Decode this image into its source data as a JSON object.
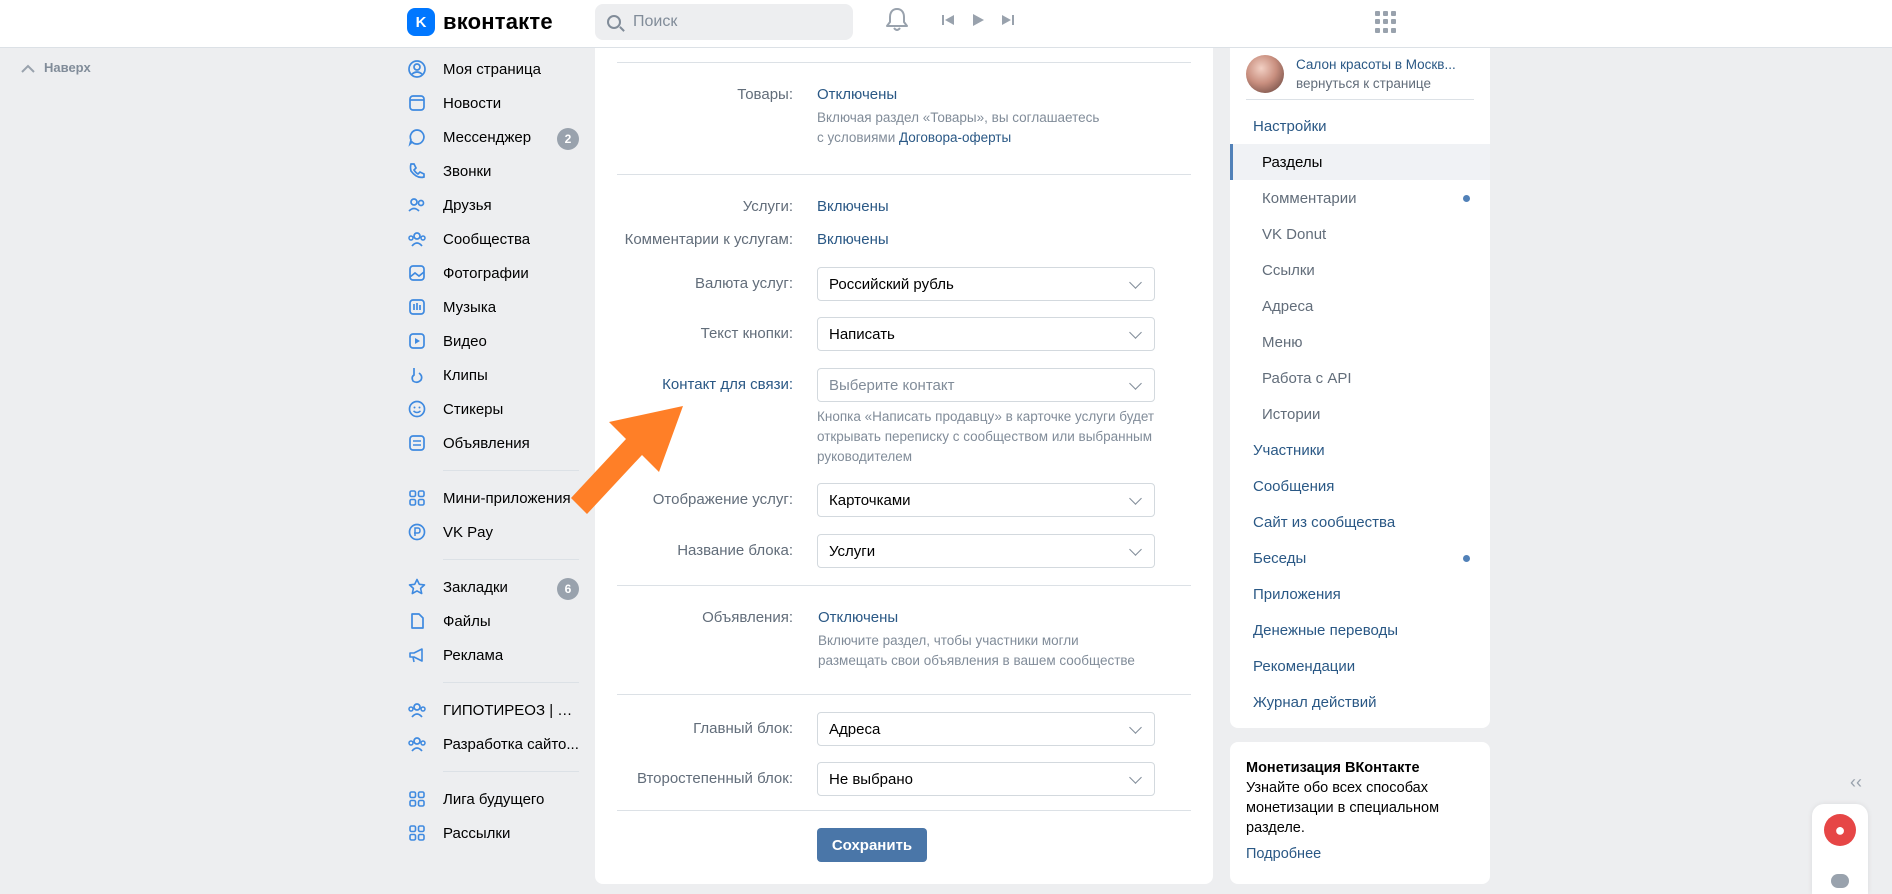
{
  "header": {
    "logo_letter": "K",
    "logo_text": "вконтакте",
    "search_placeholder": "Поиск",
    "icons": [
      "bell-icon",
      "prev-track-icon",
      "play-icon",
      "next-track-icon",
      "apps-grid-icon"
    ]
  },
  "scroll_top_label": "Наверх",
  "left_nav": {
    "group1": [
      {
        "label": "Моя страница",
        "icon": "user-circle-icon"
      },
      {
        "label": "Новости",
        "icon": "news-icon"
      },
      {
        "label": "Мессенджер",
        "icon": "message-icon",
        "badge": "2"
      },
      {
        "label": "Звонки",
        "icon": "phone-icon"
      },
      {
        "label": "Друзья",
        "icon": "friends-icon"
      },
      {
        "label": "Сообщества",
        "icon": "communities-icon"
      },
      {
        "label": "Фотографии",
        "icon": "photo-icon"
      },
      {
        "label": "Музыка",
        "icon": "music-icon"
      },
      {
        "label": "Видео",
        "icon": "video-icon"
      },
      {
        "label": "Клипы",
        "icon": "clips-icon"
      },
      {
        "label": "Стикеры",
        "icon": "smile-icon"
      },
      {
        "label": "Объявления",
        "icon": "classifieds-icon"
      }
    ],
    "group2": [
      {
        "label": "Мини-приложения",
        "icon": "apps-icon"
      },
      {
        "label": "VK Pay",
        "icon": "vkpay-icon"
      }
    ],
    "group3": [
      {
        "label": "Закладки",
        "icon": "star-icon",
        "badge": "6"
      },
      {
        "label": "Файлы",
        "icon": "file-icon"
      },
      {
        "label": "Реклама",
        "icon": "megaphone-icon"
      }
    ],
    "group4": [
      {
        "label": "ГИПОТИРЕОЗ | ПО...",
        "icon": "community-icon"
      },
      {
        "label": "Разработка сайто...",
        "icon": "community-icon"
      }
    ],
    "group5": [
      {
        "label": "Лига будущего",
        "icon": "apps-icon"
      },
      {
        "label": "Рассылки",
        "icon": "apps-icon"
      }
    ]
  },
  "form": {
    "goods": {
      "label": "Товары:",
      "value": "Отключены",
      "hint_before": "Включая раздел «Товары», вы соглашаетесь",
      "hint_line2": "с условиями ",
      "hint_link": "Договора-оферты"
    },
    "services": {
      "label": "Услуги:",
      "value": "Включены"
    },
    "service_comments": {
      "label": "Комментарии к услугам:",
      "value": "Включены"
    },
    "currency": {
      "label": "Валюта услуг:",
      "value": "Российский рубль"
    },
    "button_text": {
      "label": "Текст кнопки:",
      "value": "Написать"
    },
    "contact": {
      "label": "Контакт для связи:",
      "placeholder": "Выберите контакт",
      "hint": [
        "Кнопка «Написать продавцу» в карточке услуги будет",
        "открывать переписку с сообществом или выбранным",
        "руководителем"
      ]
    },
    "display": {
      "label": "Отображение услуг:",
      "value": "Карточками"
    },
    "block_name": {
      "label": "Название блока:",
      "value": "Услуги"
    },
    "ads": {
      "label": "Объявления:",
      "value": "Отключены",
      "hint": [
        "Включите раздел, чтобы участники могли",
        "размещать свои объявления в вашем сообществе"
      ]
    },
    "main_block": {
      "label": "Главный блок:",
      "value": "Адреса"
    },
    "secondary_block": {
      "label": "Второстепенный блок:",
      "value": "Не выбрано"
    },
    "save_label": "Сохранить"
  },
  "right_menu": {
    "group_name": "Салон красоты в Москв...",
    "group_back": "вернуться к странице",
    "items": [
      {
        "label": "Настройки",
        "type": "main"
      },
      {
        "label": "Разделы",
        "type": "active"
      },
      {
        "label": "Комментарии",
        "type": "sub",
        "dot": true
      },
      {
        "label": "VK Donut",
        "type": "sub"
      },
      {
        "label": "Ссылки",
        "type": "sub"
      },
      {
        "label": "Адреса",
        "type": "sub"
      },
      {
        "label": "Меню",
        "type": "sub"
      },
      {
        "label": "Работа с API",
        "type": "sub"
      },
      {
        "label": "Истории",
        "type": "sub"
      },
      {
        "label": "Участники",
        "type": "main"
      },
      {
        "label": "Сообщения",
        "type": "main"
      },
      {
        "label": "Сайт из сообщества",
        "type": "main"
      },
      {
        "label": "Беседы",
        "type": "main",
        "dot": true
      },
      {
        "label": "Приложения",
        "type": "main"
      },
      {
        "label": "Денежные переводы",
        "type": "main"
      },
      {
        "label": "Рекомендации",
        "type": "main"
      },
      {
        "label": "Журнал действий",
        "type": "main"
      }
    ]
  },
  "monetization": {
    "title": "Монетизация ВКонтакте",
    "text": "Узнайте обо всех способах монетизации в специальном разделе.",
    "link": "Подробнее"
  },
  "colors": {
    "accent": "#2a5885",
    "button": "#4a76a8",
    "icon": "#3f8ae0",
    "arrow": "#ff7f27",
    "background": "#edeef0"
  }
}
